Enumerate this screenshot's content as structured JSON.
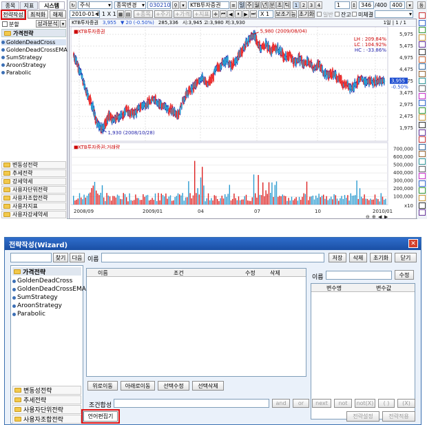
{
  "left_panel": {
    "tabs": [
      "종목",
      "지표",
      "시스템"
    ],
    "buttons": [
      "전략작성",
      "최적화",
      "해제"
    ],
    "checkbox_label": "분할",
    "perf_button": "성과분석",
    "group_title": "가격전략",
    "strategies": [
      "GoldenDeadCross",
      "GoldenDeadCrossEMA",
      "SumStrategy",
      "AroonStrategy",
      "Parabolic"
    ],
    "groups": [
      "변동성전략",
      "추세전략",
      "강세약세",
      "사용자단위전략",
      "사용자조합전략",
      "사용자지표",
      "사용자강세약세"
    ]
  },
  "toolbar1": {
    "market_select": "주식",
    "change_button": "종목변경",
    "code_input": "030210",
    "stock_name": "KTB투자증권",
    "period_buttons": [
      "일",
      "주",
      "월",
      "년",
      "분",
      "초",
      "틱"
    ],
    "interval": "1",
    "count": "346",
    "total": "/400",
    "max_input": "400",
    "menu_button": "등"
  },
  "toolbar2": {
    "date": "2010-01-21",
    "ratio": "1 X 1",
    "compare_buttons": [
      "+종목",
      "+주기",
      "+가격",
      "+지표"
    ],
    "zoom": "X 1",
    "aux_button": "보조기능",
    "reset_button": "초기화",
    "checks": [
      "일반",
      "잔고",
      "미체결"
    ]
  },
  "chart_header": {
    "name": "KTB투자증권",
    "price": "3,955",
    "change": "▼ 20 (-0.50%)",
    "volume": "285,336",
    "ohlc": "시:3,945 고:3,980 저:3,930",
    "page": "1일 | 1 / 1"
  },
  "chart_data": [
    {
      "type": "candlestick",
      "title": "KTB투자증권",
      "ylim": [
        1600,
        6000
      ],
      "y_ticks": [
        "5,975",
        "5,475",
        "4,975",
        "4,475",
        "3,975",
        "3,475",
        "2,975",
        "2,475",
        "1,975"
      ],
      "x_ticks": [
        "2008/09",
        "2009/01",
        "04",
        "07",
        "10",
        "2010/01"
      ],
      "annotations": {
        "high": "5,980 (2009/08/04)",
        "low": "1,930 (2008/10/28)",
        "lh": "LH : 209.84%",
        "lc": "LC : 104.92%",
        "hc": "HC : -33.86%",
        "last": "3,955",
        "last_change": "-0.50%"
      },
      "path_points": [
        [
          0,
          5100
        ],
        [
          5,
          4700
        ],
        [
          10,
          4200
        ],
        [
          15,
          3600
        ],
        [
          20,
          3200
        ],
        [
          25,
          2800
        ],
        [
          28,
          2300
        ],
        [
          32,
          2100
        ],
        [
          36,
          1930
        ],
        [
          40,
          2200
        ],
        [
          45,
          2500
        ],
        [
          50,
          2300
        ],
        [
          55,
          2450
        ],
        [
          60,
          2500
        ],
        [
          66,
          2750
        ],
        [
          72,
          2600
        ],
        [
          78,
          2650
        ],
        [
          84,
          2900
        ],
        [
          90,
          3000
        ],
        [
          96,
          3100
        ],
        [
          102,
          3250
        ],
        [
          108,
          3000
        ],
        [
          114,
          2900
        ],
        [
          120,
          2750
        ],
        [
          126,
          2700
        ],
        [
          132,
          2600
        ],
        [
          138,
          3200
        ],
        [
          144,
          3500
        ],
        [
          150,
          3700
        ],
        [
          156,
          3900
        ],
        [
          162,
          4200
        ],
        [
          168,
          3800
        ],
        [
          174,
          4100
        ],
        [
          180,
          4500
        ],
        [
          186,
          4700
        ],
        [
          192,
          4900
        ],
        [
          198,
          4600
        ],
        [
          204,
          4800
        ],
        [
          210,
          5200
        ],
        [
          216,
          5500
        ],
        [
          222,
          5800
        ],
        [
          226,
          5980
        ],
        [
          230,
          5700
        ],
        [
          236,
          5400
        ],
        [
          242,
          5550
        ],
        [
          248,
          5300
        ],
        [
          254,
          5400
        ],
        [
          260,
          5250
        ],
        [
          266,
          4950
        ],
        [
          272,
          5100
        ],
        [
          278,
          4800
        ],
        [
          284,
          4950
        ],
        [
          290,
          4700
        ],
        [
          296,
          4800
        ],
        [
          302,
          4550
        ],
        [
          308,
          4700
        ],
        [
          314,
          4400
        ],
        [
          320,
          4250
        ],
        [
          326,
          4300
        ],
        [
          332,
          4150
        ],
        [
          338,
          3900
        ],
        [
          344,
          3850
        ],
        [
          350,
          3700
        ],
        [
          356,
          3900
        ],
        [
          362,
          4050
        ],
        [
          368,
          3950
        ],
        [
          374,
          4000
        ],
        [
          380,
          3950
        ],
        [
          386,
          4050
        ],
        [
          392,
          3955
        ]
      ]
    },
    {
      "type": "bar",
      "title": "KTB투자증권:거래량",
      "ylim": [
        0,
        750000
      ],
      "y_ticks": [
        "700,000",
        "600,000",
        "500,000",
        "400,000",
        "300,000",
        "200,000",
        "100,000"
      ],
      "y_unit": "x10"
    }
  ],
  "dialog": {
    "title": "전략작성(Wizard)",
    "find_button": "찾기",
    "next_button": "다음",
    "name_label": "이름",
    "save_button": "저장",
    "delete_button": "삭제",
    "init_button": "초기화",
    "close_button": "닫기",
    "group_title": "가격전략",
    "strategies": [
      "GoldenDeadCross",
      "GoldenDeadCrossEMA",
      "SumStrategy",
      "AroonStrategy",
      "Parabolic"
    ],
    "groups": [
      "변동성전략",
      "추세전략",
      "사용자단위전략",
      "사용자조합전략"
    ],
    "table_headers": [
      "이름",
      "조건",
      "수정",
      "삭제"
    ],
    "var_name_label": "이름",
    "var_edit_button": "수정",
    "var_headers": [
      "변수명",
      "변수값"
    ],
    "move_buttons": [
      "위로이동",
      "아래로이동",
      "선택수정",
      "선택삭제"
    ],
    "combine_label": "조건합성",
    "logic_buttons": [
      "and",
      "or",
      "next",
      "not",
      "not(X)",
      "( )",
      "(X)"
    ],
    "lang_editor_button": "언어편집기",
    "apply_set_button": "전략설정",
    "apply_button": "전략적용"
  }
}
